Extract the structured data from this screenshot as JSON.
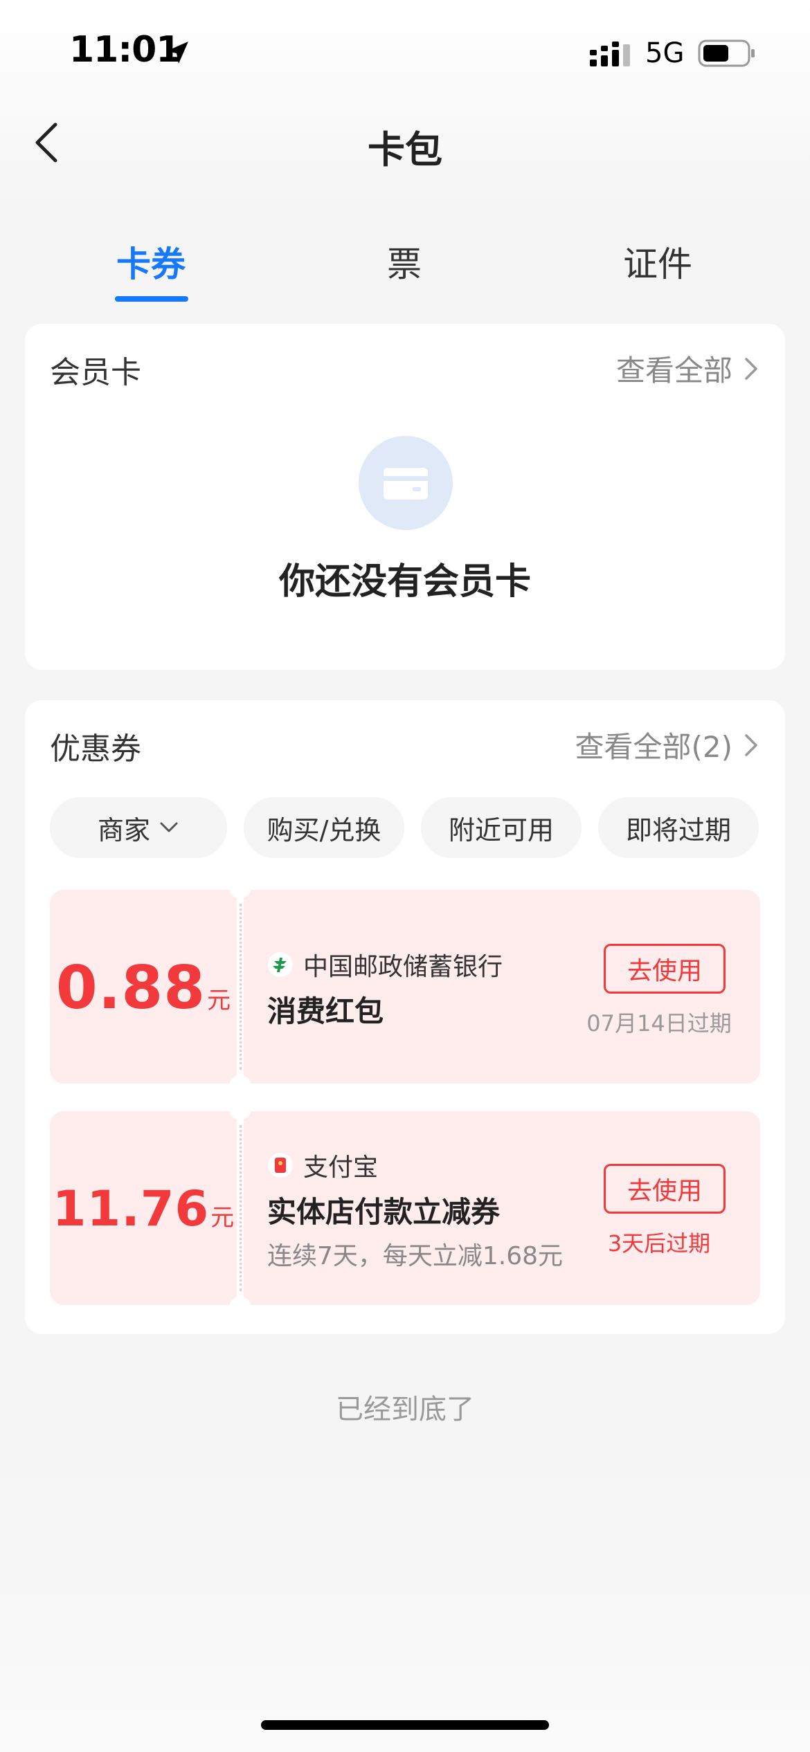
{
  "status_bar": {
    "time": "11:01",
    "network": "5G"
  },
  "nav": {
    "title": "卡包"
  },
  "tabs": [
    {
      "label": "卡券",
      "active": true
    },
    {
      "label": "票",
      "active": false
    },
    {
      "label": "证件",
      "active": false
    }
  ],
  "member_card": {
    "title": "会员卡",
    "view_all": "查看全部",
    "empty_text": "你还没有会员卡"
  },
  "coupons": {
    "title": "优惠券",
    "view_all": "查看全部(2)",
    "filters": [
      "商家",
      "购买/兑换",
      "附近可用",
      "即将过期"
    ],
    "items": [
      {
        "amount": "0.88",
        "unit": "元",
        "merchant": "中国邮政储蓄银行",
        "name": "消费红包",
        "desc": "",
        "button": "去使用",
        "expire": "07月14日过期"
      },
      {
        "amount": "11.76",
        "unit": "元",
        "merchant": "支付宝",
        "name": "实体店付款立减券",
        "desc": "连续7天，每天立减1.68元",
        "button": "去使用",
        "expire": "3天后过期"
      }
    ]
  },
  "footer": {
    "end_text": "已经到底了"
  },
  "colors": {
    "accent": "#1677ff",
    "coupon_red": "#f23a3c",
    "coupon_bg": "#ffeced"
  }
}
